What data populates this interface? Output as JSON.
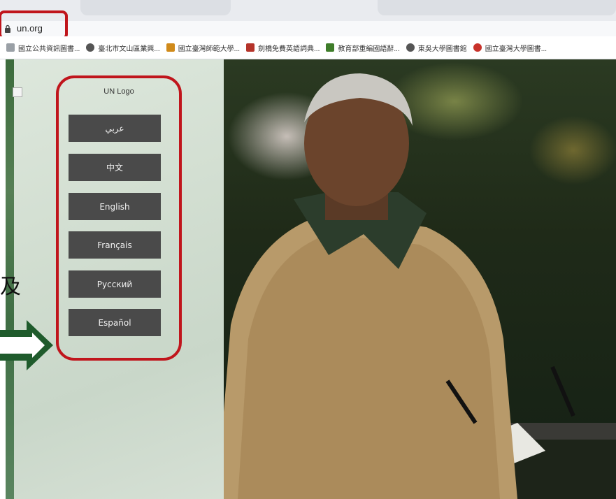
{
  "browser": {
    "url": "un.org",
    "bookmarks": [
      {
        "label": "國立公共資訊圖書...",
        "icon": "library-icon",
        "color": "#888888"
      },
      {
        "label": "臺北市文山區業興...",
        "icon": "globe-icon",
        "color": "#555555"
      },
      {
        "label": "國立臺灣師範大學...",
        "icon": "ntnu-icon",
        "color": "#d08a1a"
      },
      {
        "label": "劍橋免費英語詞典...",
        "icon": "cambridge-icon",
        "color": "#b5342a"
      },
      {
        "label": "教育部重編國語辭...",
        "icon": "moe-icon",
        "color": "#3f7d2a"
      },
      {
        "label": "東吳大學圖書館",
        "icon": "globe-icon",
        "color": "#555555"
      },
      {
        "label": "國立臺灣大學圖書...",
        "icon": "ntu-icon",
        "color": "#c8322a"
      }
    ]
  },
  "page": {
    "logo_alt": "UN Logo",
    "languages": [
      {
        "label": "عربي"
      },
      {
        "label": "中文"
      },
      {
        "label": "English"
      },
      {
        "label": "Français"
      },
      {
        "label": "Русский"
      },
      {
        "label": "Español"
      }
    ],
    "edge_char": "及"
  },
  "colors": {
    "highlight": "#c0151c",
    "button": "#4a4a4a",
    "arrow": "#1f5b2c"
  }
}
